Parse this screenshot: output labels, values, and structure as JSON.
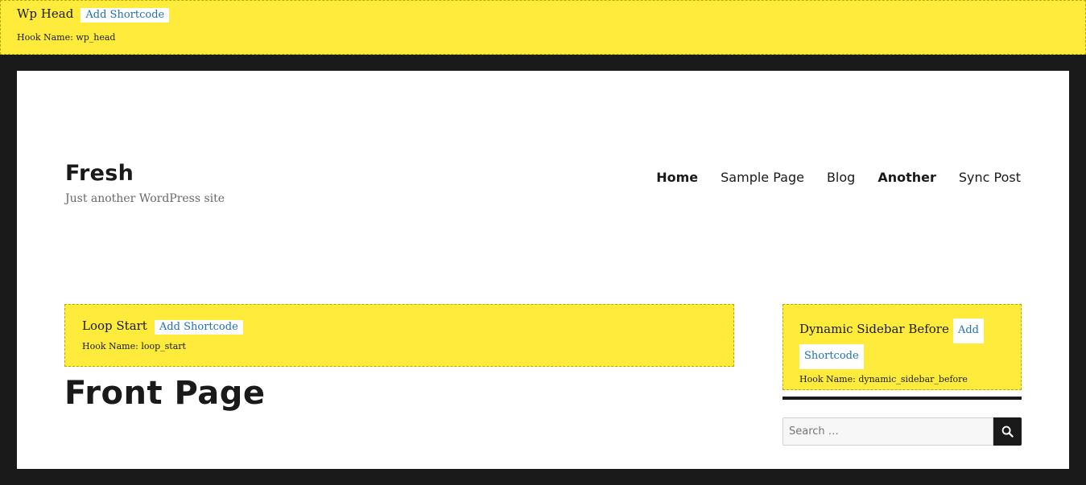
{
  "wp_head": {
    "title": "Wp Head",
    "button": "Add Shortcode",
    "hook_name": "Hook Name: wp_head"
  },
  "site": {
    "title": "Fresh",
    "tagline": "Just another WordPress site"
  },
  "nav": {
    "items": [
      {
        "label": "Home"
      },
      {
        "label": "Sample Page"
      },
      {
        "label": "Blog"
      },
      {
        "label": "Another"
      },
      {
        "label": "Sync Post"
      }
    ]
  },
  "loop_start": {
    "title": "Loop Start",
    "button": "Add Shortcode",
    "hook_name": "Hook Name: loop_start"
  },
  "page": {
    "title": "Front Page"
  },
  "sidebar_hook": {
    "title": "Dynamic Sidebar Before",
    "button_line1": "Add",
    "button_line2": "Shortcode",
    "hook_name": "Hook Name: dynamic_sidebar_before"
  },
  "search": {
    "placeholder": "Search …",
    "icon": "search-icon"
  },
  "colors": {
    "hook_background": "#ffeb3b",
    "page_background": "#1a1a1a",
    "link": "#2271b1"
  }
}
